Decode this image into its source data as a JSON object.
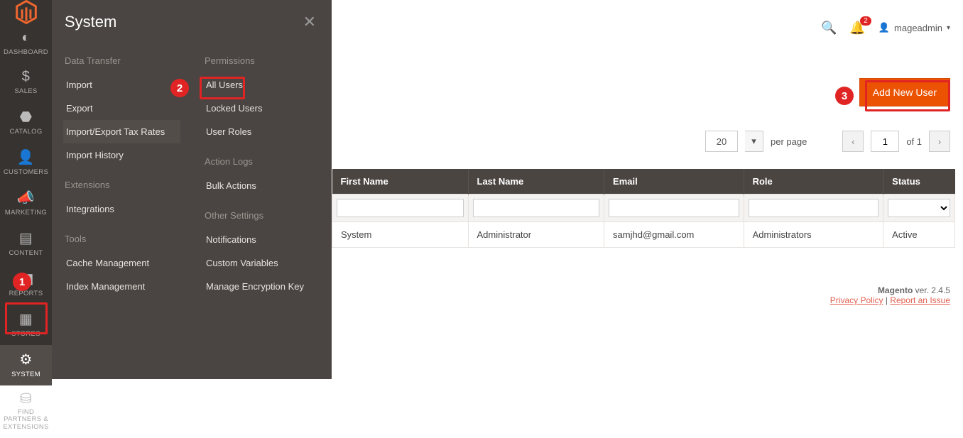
{
  "nav": {
    "items": [
      {
        "label": "DASHBOARD"
      },
      {
        "label": "SALES"
      },
      {
        "label": "CATALOG"
      },
      {
        "label": "CUSTOMERS"
      },
      {
        "label": "MARKETING"
      },
      {
        "label": "CONTENT"
      },
      {
        "label": "REPORTS"
      },
      {
        "label": "STORES"
      },
      {
        "label": "SYSTEM"
      },
      {
        "label": "FIND PARTNERS\n& EXTENSIONS"
      }
    ]
  },
  "flyout": {
    "title": "System",
    "groups_left": [
      {
        "title": "Data Transfer",
        "items": [
          "Import",
          "Export",
          "Import/Export Tax Rates",
          "Import History"
        ]
      },
      {
        "title": "Extensions",
        "items": [
          "Integrations"
        ]
      },
      {
        "title": "Tools",
        "items": [
          "Cache Management",
          "Index Management"
        ]
      }
    ],
    "groups_right": [
      {
        "title": "Permissions",
        "items": [
          "All Users",
          "Locked Users",
          "User Roles"
        ]
      },
      {
        "title": "Action Logs",
        "items": [
          "Bulk Actions"
        ]
      },
      {
        "title": "Other Settings",
        "items": [
          "Notifications",
          "Custom Variables",
          "Manage Encryption Key"
        ]
      }
    ]
  },
  "callouts": {
    "c1": "1",
    "c2": "2",
    "c3": "3"
  },
  "header": {
    "notifications_count": "2",
    "username": "mageadmin"
  },
  "action": {
    "add_new_user": "Add New User"
  },
  "pager": {
    "page_size": "20",
    "per_page_label": "per page",
    "current_page": "1",
    "of_label": "of 1"
  },
  "table": {
    "columns": [
      "First Name",
      "Last Name",
      "Email",
      "Role",
      "Status"
    ],
    "rows": [
      {
        "first": "System",
        "last": "Administrator",
        "email": "samjhd@gmail.com",
        "role": "Administrators",
        "status": "Active"
      }
    ]
  },
  "footer": {
    "product": "Magento",
    "version": "ver. 2.4.5",
    "privacy": "Privacy Policy",
    "report": "Report an Issue"
  }
}
